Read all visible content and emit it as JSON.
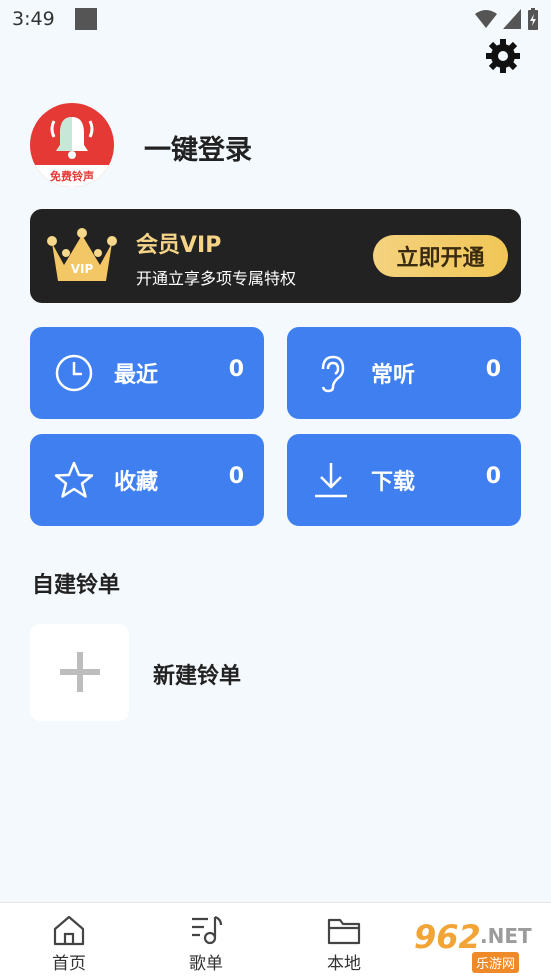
{
  "status_bar": {
    "time": "3:49"
  },
  "profile": {
    "login_label": "一键登录",
    "avatar_badge": "免费铃声"
  },
  "vip": {
    "title": "会员VIP",
    "subtitle": "开通立享多项专属特权",
    "button": "立即开通"
  },
  "tiles": [
    {
      "label": "最近",
      "count": "0",
      "icon": "clock-icon"
    },
    {
      "label": "常听",
      "count": "0",
      "icon": "ear-icon"
    },
    {
      "label": "收藏",
      "count": "0",
      "icon": "star-icon"
    },
    {
      "label": "下载",
      "count": "0",
      "icon": "download-icon"
    }
  ],
  "custom_lists": {
    "title": "自建铃单",
    "new_label": "新建铃单"
  },
  "nav": [
    {
      "label": "首页",
      "icon": "home-icon"
    },
    {
      "label": "歌单",
      "icon": "playlist-icon"
    },
    {
      "label": "本地",
      "icon": "folder-icon"
    }
  ],
  "watermark": {
    "brand": "962",
    "net": ".NET",
    "sub": "乐游网"
  },
  "colors": {
    "background": "#f3f9fd",
    "tile_blue": "#3f7ff0",
    "vip_dark": "#222222",
    "vip_gold": "#f0c656",
    "avatar_red": "#e53935"
  }
}
